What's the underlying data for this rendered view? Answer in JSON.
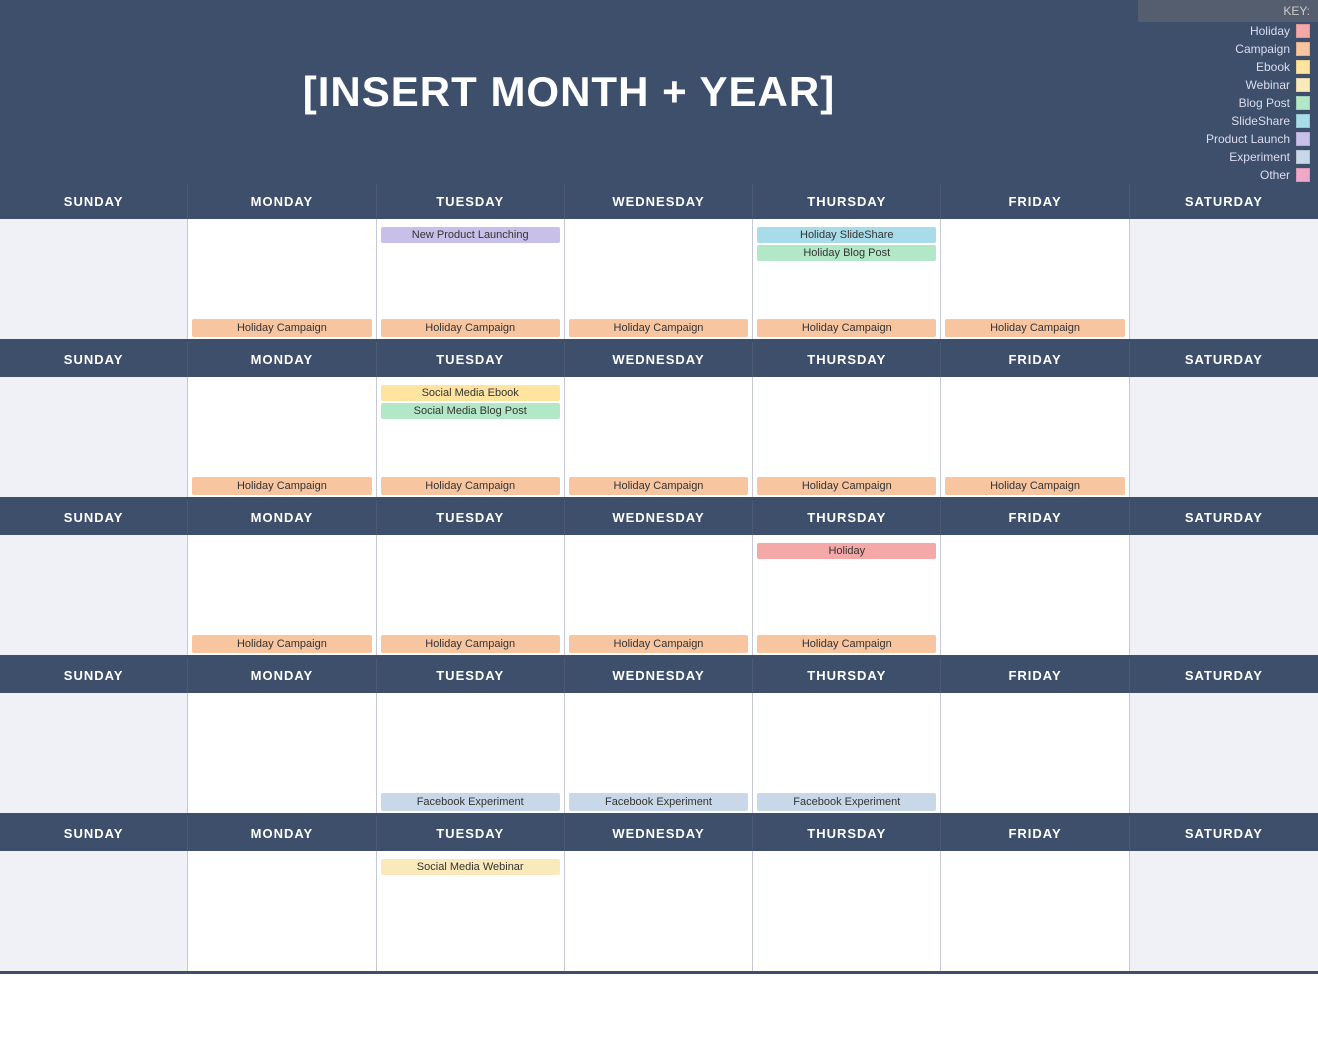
{
  "header": {
    "title": "[INSERT MONTH + YEAR]"
  },
  "key": {
    "title": "KEY:",
    "items": [
      {
        "label": "Holiday",
        "color": "#f4a8a8",
        "name": "holiday"
      },
      {
        "label": "Campaign",
        "color": "#f7c5a0",
        "name": "campaign"
      },
      {
        "label": "Ebook",
        "color": "#ffe4a0",
        "name": "ebook"
      },
      {
        "label": "Webinar",
        "color": "#faeabb",
        "name": "webinar"
      },
      {
        "label": "Blog Post",
        "color": "#b2e8c8",
        "name": "blogpost"
      },
      {
        "label": "SlideShare",
        "color": "#a8dce8",
        "name": "slideshare"
      },
      {
        "label": "Product Launch",
        "color": "#c8c0e8",
        "name": "launch"
      },
      {
        "label": "Experiment",
        "color": "#c8d8e8",
        "name": "experiment"
      },
      {
        "label": "Other",
        "color": "#f0a8c8",
        "name": "other"
      }
    ]
  },
  "days": {
    "headers": [
      "SUNDAY",
      "MONDAY",
      "TUESDAY",
      "WEDNESDAY",
      "THURSDAY",
      "FRIDAY",
      "SATURDAY"
    ]
  },
  "weeks": [
    {
      "cells": [
        {
          "bg": "light",
          "topEvents": [],
          "bottomTag": null
        },
        {
          "bg": "white",
          "topEvents": [],
          "bottomTag": {
            "label": "Holiday Campaign",
            "class": "tag-campaign"
          }
        },
        {
          "bg": "white",
          "topEvents": [
            {
              "label": "New Product Launching",
              "class": "tag-launch"
            }
          ],
          "bottomTag": {
            "label": "Holiday Campaign",
            "class": "tag-campaign"
          }
        },
        {
          "bg": "white",
          "topEvents": [],
          "bottomTag": {
            "label": "Holiday Campaign",
            "class": "tag-campaign"
          }
        },
        {
          "bg": "white",
          "topEvents": [
            {
              "label": "Holiday SlideShare",
              "class": "tag-slideshare"
            },
            {
              "label": "Holiday Blog Post",
              "class": "tag-blogpost"
            }
          ],
          "bottomTag": {
            "label": "Holiday Campaign",
            "class": "tag-campaign"
          }
        },
        {
          "bg": "white",
          "topEvents": [],
          "bottomTag": {
            "label": "Holiday Campaign",
            "class": "tag-campaign"
          }
        },
        {
          "bg": "light",
          "topEvents": [],
          "bottomTag": null
        }
      ]
    },
    {
      "cells": [
        {
          "bg": "light",
          "topEvents": [],
          "bottomTag": null
        },
        {
          "bg": "white",
          "topEvents": [],
          "bottomTag": {
            "label": "Holiday Campaign",
            "class": "tag-campaign"
          }
        },
        {
          "bg": "white",
          "topEvents": [
            {
              "label": "Social Media Ebook",
              "class": "tag-ebook"
            },
            {
              "label": "Social Media Blog Post",
              "class": "tag-blogpost"
            }
          ],
          "bottomTag": {
            "label": "Holiday Campaign",
            "class": "tag-campaign"
          }
        },
        {
          "bg": "white",
          "topEvents": [],
          "bottomTag": {
            "label": "Holiday Campaign",
            "class": "tag-campaign"
          }
        },
        {
          "bg": "white",
          "topEvents": [],
          "bottomTag": {
            "label": "Holiday Campaign",
            "class": "tag-campaign"
          }
        },
        {
          "bg": "white",
          "topEvents": [],
          "bottomTag": {
            "label": "Holiday Campaign",
            "class": "tag-campaign"
          }
        },
        {
          "bg": "light",
          "topEvents": [],
          "bottomTag": null
        }
      ]
    },
    {
      "cells": [
        {
          "bg": "light",
          "topEvents": [],
          "bottomTag": null
        },
        {
          "bg": "white",
          "topEvents": [],
          "bottomTag": {
            "label": "Holiday Campaign",
            "class": "tag-campaign"
          }
        },
        {
          "bg": "white",
          "topEvents": [],
          "bottomTag": {
            "label": "Holiday Campaign",
            "class": "tag-campaign"
          }
        },
        {
          "bg": "white",
          "topEvents": [],
          "bottomTag": {
            "label": "Holiday Campaign",
            "class": "tag-campaign"
          }
        },
        {
          "bg": "white",
          "topEvents": [
            {
              "label": "Holiday",
              "class": "tag-holiday"
            }
          ],
          "bottomTag": {
            "label": "Holiday Campaign",
            "class": "tag-campaign"
          }
        },
        {
          "bg": "white",
          "topEvents": [],
          "bottomTag": null
        },
        {
          "bg": "light",
          "topEvents": [],
          "bottomTag": null
        }
      ]
    },
    {
      "cells": [
        {
          "bg": "light",
          "topEvents": [],
          "bottomTag": null
        },
        {
          "bg": "white",
          "topEvents": [],
          "bottomTag": null
        },
        {
          "bg": "white",
          "topEvents": [],
          "bottomTag": {
            "label": "Facebook Experiment",
            "class": "tag-experiment"
          }
        },
        {
          "bg": "white",
          "topEvents": [],
          "bottomTag": {
            "label": "Facebook Experiment",
            "class": "tag-experiment"
          }
        },
        {
          "bg": "white",
          "topEvents": [],
          "bottomTag": {
            "label": "Facebook Experiment",
            "class": "tag-experiment"
          }
        },
        {
          "bg": "white",
          "topEvents": [],
          "bottomTag": null
        },
        {
          "bg": "light",
          "topEvents": [],
          "bottomTag": null
        }
      ]
    },
    {
      "cells": [
        {
          "bg": "light",
          "topEvents": [],
          "bottomTag": null
        },
        {
          "bg": "white",
          "topEvents": [],
          "bottomTag": null
        },
        {
          "bg": "white",
          "topEvents": [
            {
              "label": "Social Media Webinar",
              "class": "tag-webinar"
            }
          ],
          "bottomTag": null
        },
        {
          "bg": "white",
          "topEvents": [],
          "bottomTag": null
        },
        {
          "bg": "white",
          "topEvents": [],
          "bottomTag": null
        },
        {
          "bg": "white",
          "topEvents": [],
          "bottomTag": null
        },
        {
          "bg": "light",
          "topEvents": [],
          "bottomTag": null
        }
      ]
    }
  ]
}
